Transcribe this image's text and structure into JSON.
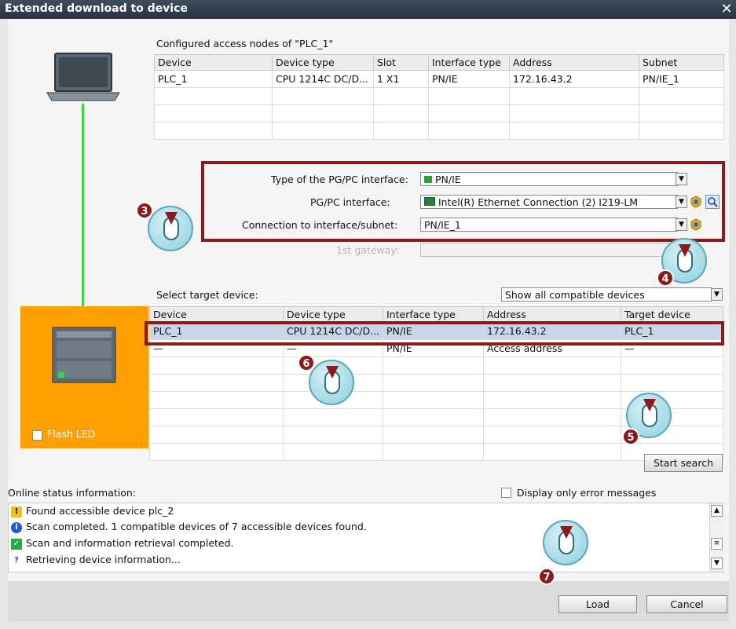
{
  "window": {
    "title": "Extended download to device",
    "close_glyph": "✕"
  },
  "configured": {
    "heading": "Configured access nodes of \"PLC_1\"",
    "columns": [
      "Device",
      "Device type",
      "Slot",
      "Interface type",
      "Address",
      "Subnet"
    ],
    "rows": [
      [
        "PLC_1",
        "CPU 1214C DC/D...",
        "1 X1",
        "PN/IE",
        "172.16.43.2",
        "PN/IE_1"
      ]
    ]
  },
  "interface": {
    "type_label": "Type of the PG/PC interface:",
    "type_value": "PN/IE",
    "pgpc_label": "PG/PC interface:",
    "pgpc_value": "Intel(R) Ethernet Connection (2) I219-LM",
    "conn_label": "Connection to interface/subnet:",
    "conn_value": "PN/IE_1",
    "gateway_label": "1st gateway:"
  },
  "target": {
    "heading": "Select target device:",
    "filter_value": "Show all compatible devices",
    "columns": [
      "Device",
      "Device type",
      "Interface type",
      "Address",
      "Target device"
    ],
    "rows": [
      [
        "PLC_1",
        "CPU 1214C DC/D...",
        "PN/IE",
        "172.16.43.2",
        "PLC_1"
      ],
      [
        "—",
        "—",
        "PN/IE",
        "Access address",
        "—"
      ]
    ]
  },
  "flash_led_label": "Flash LED",
  "start_search_label": "Start search",
  "status": {
    "heading": "Online status information:",
    "error_only_label": "Display only error messages",
    "messages": [
      {
        "icon": "warning-icon",
        "text": "Found accessible device plc_2"
      },
      {
        "icon": "info-icon",
        "text": "Scan completed. 1 compatible devices of 7 accessible devices found."
      },
      {
        "icon": "check-icon",
        "text": "Scan and information retrieval completed."
      },
      {
        "icon": "network-question-icon",
        "text": "Retrieving device information..."
      }
    ]
  },
  "buttons": {
    "load": "Load",
    "cancel": "Cancel"
  },
  "callouts": [
    "3",
    "4",
    "5",
    "6",
    "7"
  ],
  "colors": {
    "accent_orange": "#ff9f00",
    "callout_red": "#8b1a1a",
    "link_green": "#3fd43f"
  }
}
